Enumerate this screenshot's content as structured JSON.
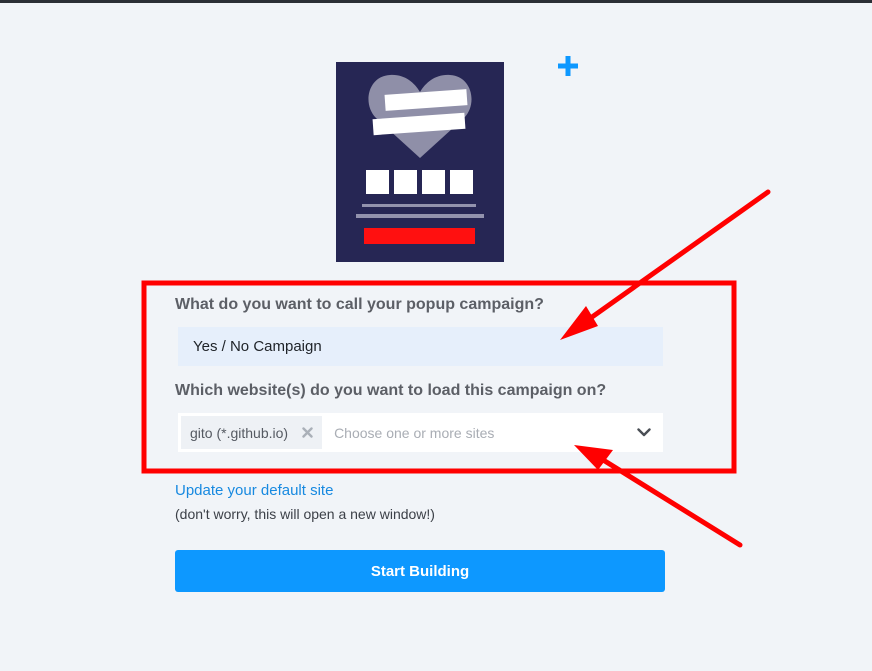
{
  "form": {
    "campaign_name_label": "What do you want to call your popup campaign?",
    "campaign_name_value": "Yes / No Campaign",
    "websites_label": "Which website(s) do you want to load this campaign on?",
    "selected_sites": [
      "gito (*.github.io)"
    ],
    "websites_placeholder": "Choose one or more sites",
    "update_link": "Update your default site",
    "note": "(don't worry, this will open a new window!)",
    "start_button": "Start Building"
  },
  "icons": {
    "add": "plus-icon",
    "remove_chip": "x-icon",
    "dropdown": "chevron-down-icon"
  },
  "colors": {
    "accent": "#0d98ff",
    "link": "#1789e0",
    "annotation": "#ff0000",
    "preview_bg": "#262654"
  }
}
